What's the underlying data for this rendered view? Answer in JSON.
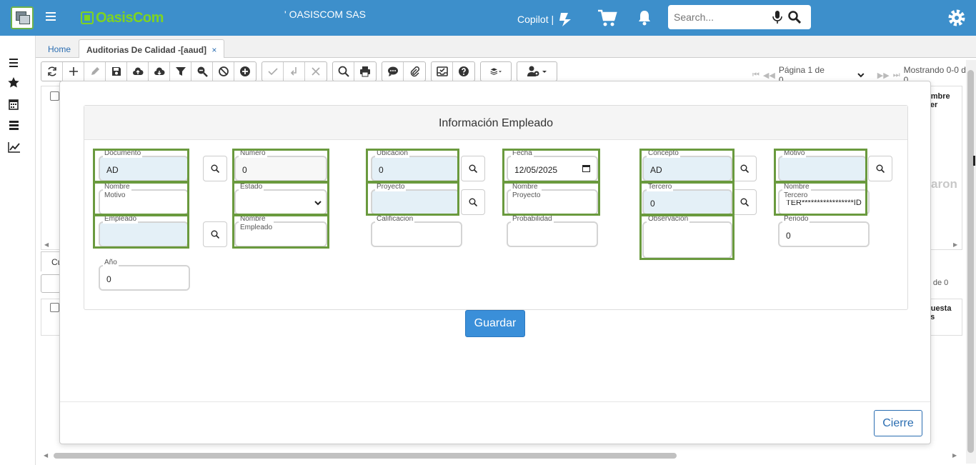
{
  "header": {
    "brand": "OasisCom",
    "company": "' OASISCOM SAS",
    "copilot_label": "Copilot |",
    "search_placeholder": "Search..."
  },
  "tabs": [
    {
      "label": "Home"
    },
    {
      "label": "Auditorias De Calidad -[aaud]",
      "close": "×"
    }
  ],
  "pager": {
    "page_label": "Página 1 de 0",
    "showing": "Mostrando 0-0 de 0"
  },
  "background": {
    "col_header_1": "ombre Ter",
    "faint_text": "aron",
    "tab_label": "Cu",
    "showing_2": "-0 de 0",
    "col_header_2": "puesta es"
  },
  "modal": {
    "panel_title": "Información Empleado",
    "save_label": "Guardar",
    "close_label": "Cierre",
    "fields": {
      "documento": {
        "label": "Documento",
        "value": "AD"
      },
      "numero": {
        "label": "Numero",
        "value": "0"
      },
      "ubicacion": {
        "label": "Ubicación",
        "value": "0"
      },
      "fecha": {
        "label": "Fecha",
        "value": "12/05/2025"
      },
      "concepto": {
        "label": "Concepto",
        "value": "AD"
      },
      "motivo": {
        "label": "Motivo",
        "value": ""
      },
      "nombre_motivo": {
        "label": "Nombre Motivo",
        "value": ""
      },
      "estado": {
        "label": "Estado",
        "value": ""
      },
      "proyecto": {
        "label": "Proyecto",
        "value": ""
      },
      "nombre_proyecto": {
        "label": "Nombre Proyecto",
        "value": ""
      },
      "tercero": {
        "label": "Tercero",
        "value": "0"
      },
      "nombre_tercero": {
        "label": "Nombre Tercero",
        "value": "TER*****************ID"
      },
      "empleado": {
        "label": "Empleado",
        "value": ""
      },
      "nombre_empleado": {
        "label": "Nombre Empleado",
        "value": ""
      },
      "calificacion": {
        "label": "Calificacion",
        "value": ""
      },
      "probabilidad": {
        "label": "Probabilidad",
        "value": ""
      },
      "observacion": {
        "label": "Observacion",
        "value": ""
      },
      "periodo": {
        "label": "Periodo",
        "value": "0"
      },
      "anio": {
        "label": "Año",
        "value": "0"
      }
    }
  },
  "colors": {
    "header_bg": "#3d8fcb",
    "brand_green": "#7ed321",
    "highlight": "#6a9a3e",
    "field_blue": "#e4f0f7",
    "primary": "#3a8fd9"
  }
}
